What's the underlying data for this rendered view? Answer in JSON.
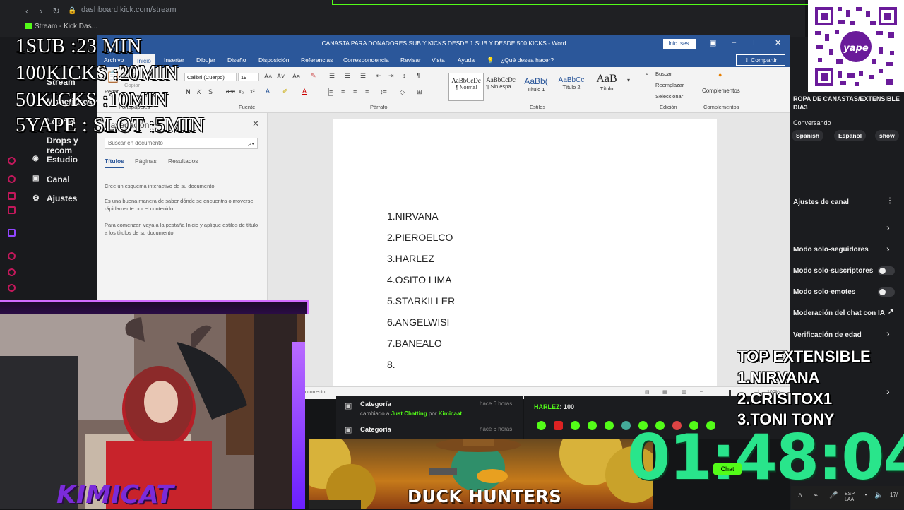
{
  "browser": {
    "url": "dashboard.kick.com/stream",
    "tab_title": "Stream - Kick Das..."
  },
  "sidebar": {
    "items": [
      {
        "label": "Stream"
      },
      {
        "label": "Monetización"
      },
      {
        "label": "Logros"
      },
      {
        "label": "Drops y recom"
      },
      {
        "label": "Estudio"
      },
      {
        "label": "Canal"
      },
      {
        "label": "Ajustes"
      }
    ]
  },
  "overlay": {
    "line1": "1SUB :23 MIN",
    "line2": "100KICKS :20MIN",
    "line3": "50KICKS :10MIN",
    "line4": "5YAPE : SLOT :5MIN"
  },
  "word": {
    "title": "CANASTA PARA DONADORES SUB Y KICKS DESDE 1 SUB Y DESDE 500 KICKS  -  Word",
    "signin": "Inic. ses.",
    "share": "Compartir",
    "menu": [
      "Archivo",
      "Inicio",
      "Insertar",
      "Dibujar",
      "Diseño",
      "Disposición",
      "Referencias",
      "Correspondencia",
      "Revisar",
      "Vista",
      "Ayuda",
      "¿Qué desea hacer?"
    ],
    "ribbon": {
      "paste": "Pegar",
      "cut": "Cortar",
      "copy": "Copiar",
      "format_painter": "Copiar formato",
      "clipboard_group": "Portapapeles",
      "font_name": "Calibri (Cuerpo)",
      "font_size": "19",
      "font_group": "Fuente",
      "paragraph_group": "Párrafo",
      "styles_group": "Estilos",
      "styles": [
        {
          "sample": "AaBbCcDc",
          "name": "¶ Normal"
        },
        {
          "sample": "AaBbCcDc",
          "name": "¶ Sin espa..."
        },
        {
          "sample": "AaBb(",
          "name": "Título 1"
        },
        {
          "sample": "AaBbCc",
          "name": "Título 2"
        },
        {
          "sample": "AaB",
          "name": "Título"
        }
      ],
      "find": "Buscar",
      "replace": "Reemplazar",
      "select": "Seleccionar",
      "editing_group": "Edición",
      "addins": "Complementos",
      "addins_group": "Complementos"
    },
    "nav": {
      "title": "Navegación",
      "search_placeholder": "Buscar en documento",
      "tabs": [
        "Títulos",
        "Páginas",
        "Resultados"
      ],
      "p1": "Cree un esquema interactivo de su documento.",
      "p2": "Es una buena manera de saber dónde se encuentra o moverse rápidamente por el contenido.",
      "p3": "Para comenzar, vaya a la pestaña Inicio y aplique estilos de título a los títulos de su documento."
    },
    "document_lines": [
      "1.NIRVANA",
      "2.PIEROELCO",
      "3.HARLEZ",
      "4.OSITO LIMA",
      "5.STARKILLER",
      "6.ANGELWISI",
      "7.BANEALO",
      "8."
    ],
    "status": "Todo correcto",
    "zoom": "100%"
  },
  "right_panel": {
    "stream_title": "ROPA DE CANASTAS/EXTENSIBLE DIA3",
    "category": "Conversando",
    "tags": [
      "Spanish",
      "Español",
      "show"
    ],
    "section": "Ajustes de canal",
    "items": [
      {
        "label": "Modo solo-seguidores"
      },
      {
        "label": "Modo solo-suscriptores"
      },
      {
        "label": "Modo solo-emotes"
      },
      {
        "label": "Moderación del chat con IA"
      },
      {
        "label": "Verificación de edad"
      }
    ]
  },
  "feed": {
    "items": [
      {
        "title": "Categoría",
        "sub_prefix": "cambiado a ",
        "category": "Just Chatting",
        "by": " por ",
        "user": "Kimicaat",
        "time": "hace 6 horas"
      },
      {
        "title": "Categoría",
        "time": "hace 6 horas"
      }
    ]
  },
  "chat": {
    "user": "HARLEZ",
    "message": ": 100",
    "send": "Chat"
  },
  "game": {
    "title": "DUCK HUNTERS"
  },
  "streamer_name": "KIMICAT",
  "top_extensible": {
    "title": "TOP EXTENSIBLE",
    "entries": [
      "1.NIRVANA",
      "2.CRISITOX1",
      "3.TONI TONY"
    ]
  },
  "timer": "01:48:04",
  "taskbar": {
    "lang": "ESP",
    "lang2": "LAA",
    "date": "17/"
  },
  "colors": {
    "word_blue": "#2b579a",
    "kick_green": "#53fc18",
    "timer_green": "#29e58b",
    "neon_purple": "#d06bff"
  }
}
